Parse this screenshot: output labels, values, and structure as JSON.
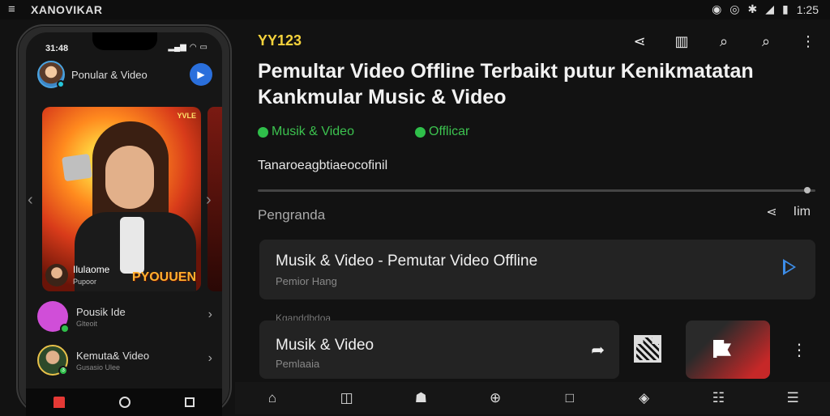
{
  "statusbar": {
    "menu_icon": "hamburger-icon",
    "brand": "XANOVIKAR",
    "icons": [
      "record-icon",
      "alarm-icon",
      "data-icon",
      "signal-icon",
      "battery-icon"
    ],
    "time": "1:25"
  },
  "phone": {
    "time": "31:48",
    "header_title": "Ponular & Video",
    "hero": {
      "badge": "YVLE",
      "caption": "PYOUUEN",
      "mini_name": "Ilulaome",
      "mini_sub": "Pupoor"
    },
    "list": [
      {
        "title": "Pousik Ide",
        "sub": "Glteoit",
        "avatar_color": "#d04ed8"
      },
      {
        "title": "Kemuta& Video",
        "sub": "Gusasio Ulee",
        "avatar_color": "#e8c14a"
      }
    ]
  },
  "main": {
    "channel": "YY123",
    "top_icons": [
      "share-icon",
      "library-icon",
      "search-icon",
      "search-icon",
      "more-icon"
    ],
    "headline_line1": "Pemultar Video Offline Terbaikt putur Kenikmatatan",
    "headline_line2": "Kankmular Music & Video",
    "tag1": "Musik & Video",
    "tag2": "Offlicar",
    "description": "Tanaroeagbtiaeocofinil",
    "section1": "Pengranda",
    "share_label": "Iim",
    "card1": {
      "title": "Musik & Video - Pemutar Video Offline",
      "subtitle": "Pemior Hang"
    },
    "section2": "Kganddbdoa",
    "card2": {
      "title": "Musik & Video",
      "subtitle": "Pemlaaia"
    }
  },
  "colors": {
    "accent_yellow": "#f4d23c",
    "accent_green": "#3cc24f",
    "play_blue": "#3d8de8",
    "brand_red": "#e53935"
  }
}
